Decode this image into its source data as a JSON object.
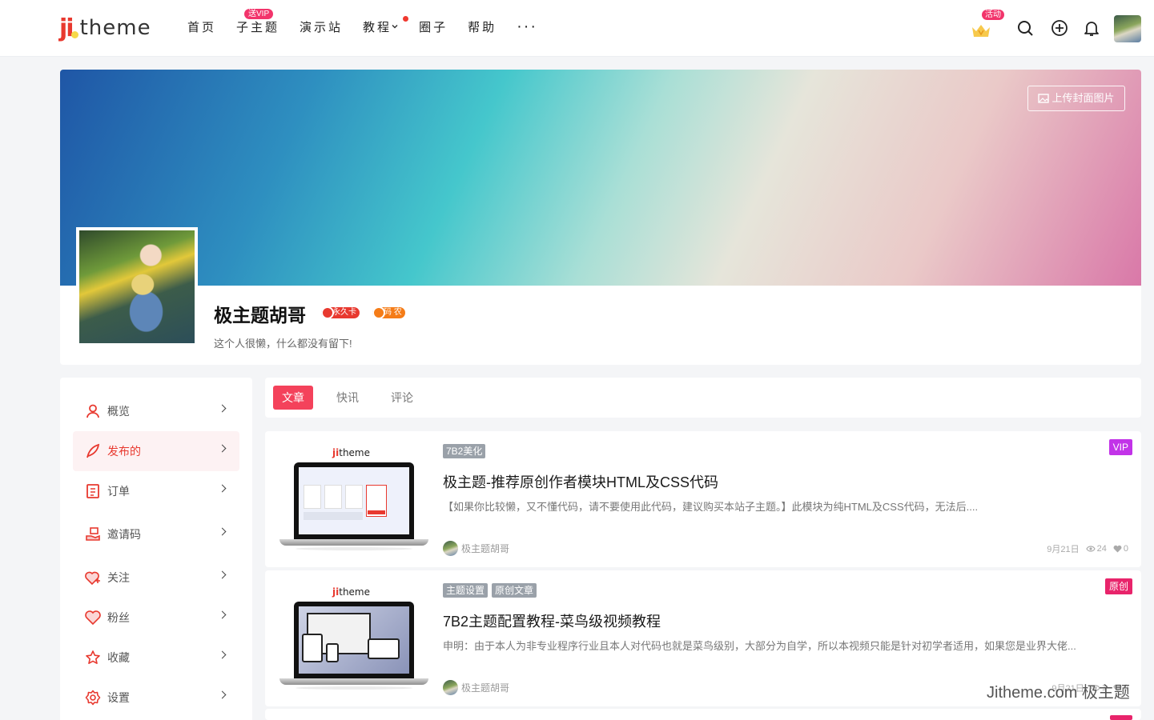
{
  "header": {
    "logo_ji": "ji",
    "logo_theme": "theme",
    "nav": [
      {
        "label": "首页"
      },
      {
        "label": "子主题",
        "badge": "送VIP"
      },
      {
        "label": "演示站"
      },
      {
        "label": "教程",
        "has_dropdown": true,
        "has_dot": true
      },
      {
        "label": "圈子"
      },
      {
        "label": "帮助"
      }
    ],
    "more_label": "···",
    "activity_badge": "活动",
    "icons": [
      "crown-icon",
      "search-icon",
      "plus-circle-icon",
      "bell-icon"
    ]
  },
  "profile": {
    "upload_cover_label": "上传封面图片",
    "username": "极主题胡哥",
    "badges": [
      {
        "label": "永久卡",
        "color": "#e8392f"
      },
      {
        "label": "码 农",
        "color": "#f57c17"
      }
    ],
    "bio": "这个人很懒，什么都没有留下!"
  },
  "sidebar": {
    "items": [
      {
        "label": "概览",
        "icon": "user-icon"
      },
      {
        "label": "发布的",
        "icon": "feather-icon",
        "active": true
      },
      {
        "label": "订单",
        "icon": "order-icon"
      },
      {
        "label": "邀请码",
        "icon": "invite-icon"
      },
      {
        "label": "关注",
        "icon": "heart-plus-icon"
      },
      {
        "label": "粉丝",
        "icon": "heart-icon"
      },
      {
        "label": "收藏",
        "icon": "star-icon"
      },
      {
        "label": "设置",
        "icon": "gear-icon"
      }
    ]
  },
  "tabs": [
    {
      "label": "文章",
      "active": true
    },
    {
      "label": "快讯"
    },
    {
      "label": "评论"
    }
  ],
  "posts": [
    {
      "thumb_brand_ji": "ji",
      "thumb_brand_theme": "theme",
      "tags": [
        "7B2美化"
      ],
      "title": "极主题-推荐原创作者模块HTML及CSS代码",
      "excerpt": "【如果你比较懒，又不懂代码，请不要使用此代码，建议购买本站子主题。】此模块为纯HTML及CSS代码，无法后....",
      "author": "极主题胡哥",
      "date": "9月21日",
      "views": "24",
      "likes": "0",
      "corner_badge": "VIP",
      "corner_color": "#c233e8"
    },
    {
      "thumb_brand_ji": "ji",
      "thumb_brand_theme": "theme",
      "tags": [
        "主题设置",
        "原创文章"
      ],
      "title": "7B2主题配置教程-菜鸟级视频教程",
      "excerpt": "申明：由于本人为非专业程序行业且本人对代码也就是菜鸟级别，大部分为自学，所以本视频只能是针对初学者适用，如果您是业界大佬...",
      "author": "极主题胡哥",
      "date": "9月21日",
      "views": "1",
      "likes": "0",
      "corner_badge": "原创",
      "corner_color": "#e8246b"
    }
  ],
  "watermark": "Jitheme.com 极主题",
  "colors": {
    "accent": "#f4425b",
    "brand_red": "#e8392f",
    "vip": "#c233e8"
  }
}
